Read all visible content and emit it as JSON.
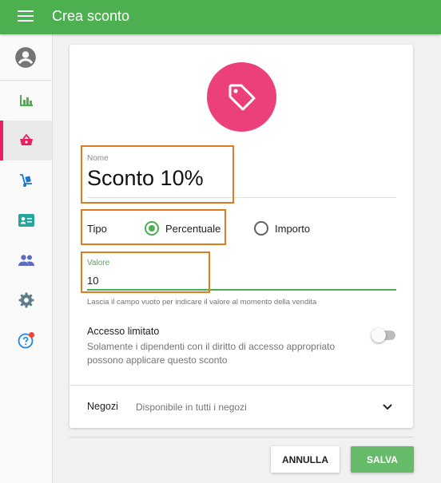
{
  "header": {
    "title": "Crea sconto",
    "menu_icon": "hamburger-menu-icon",
    "color": "#4caf50"
  },
  "sidebar": {
    "profile_icon": "account-circle-icon",
    "items": [
      {
        "icon": "bar-chart-icon",
        "color": "#4caf50",
        "active": false
      },
      {
        "icon": "shopping-basket-icon",
        "color": "#e91e63",
        "active": true
      },
      {
        "icon": "hand-truck-icon",
        "color": "#1976d2",
        "active": false
      },
      {
        "icon": "id-card-icon",
        "color": "#26a69a",
        "active": false
      },
      {
        "icon": "people-icon",
        "color": "#5c6bc0",
        "active": false
      },
      {
        "icon": "gear-icon",
        "color": "#607d8b",
        "active": false
      },
      {
        "icon": "help-icon",
        "color": "#1e88e5",
        "active": false,
        "notification_dot": "#f44336"
      }
    ]
  },
  "form": {
    "icon": "tag-icon",
    "icon_bg": "#ec407a",
    "name_label": "Nome",
    "name_value": "Sconto 10%",
    "tipo_label": "Tipo",
    "tipo_options": [
      {
        "label": "Percentuale",
        "checked": true
      },
      {
        "label": "Importo",
        "checked": false
      }
    ],
    "valore_label": "Valore",
    "valore_value": "10",
    "valore_help": "Lascia il campo vuoto per indicare il valore al momento della vendita",
    "access_title": "Accesso limitato",
    "access_desc": "Solamente i dipendenti con il diritto di accesso appropriato possono applicare questo sconto",
    "access_enabled": false,
    "negozi_label": "Negozi",
    "negozi_value": "Disponibile in tutti i negozi"
  },
  "actions": {
    "cancel_label": "ANNULLA",
    "save_label": "SALVA",
    "save_color": "#66bb6a"
  }
}
